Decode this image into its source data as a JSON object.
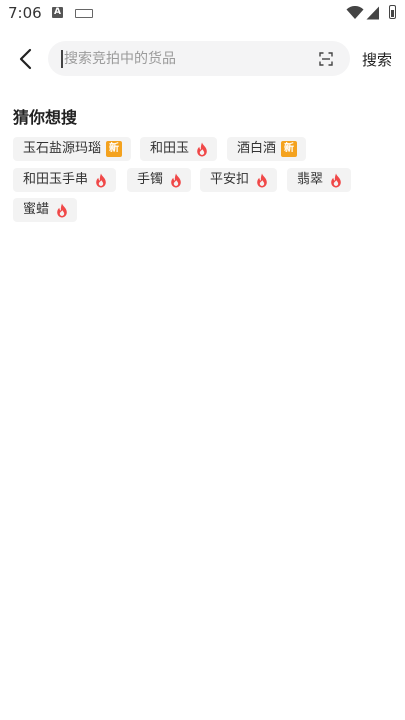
{
  "status_bar": {
    "time": "7:06",
    "notif_letter": "A"
  },
  "search": {
    "placeholder": "搜索竞拍中的货品",
    "button_label": "搜索"
  },
  "suggestions": {
    "title": "猜你想搜",
    "tags": [
      {
        "label": "玉石盐源玛瑙",
        "badge": "new",
        "badge_text": "新"
      },
      {
        "label": "和田玉",
        "badge": "hot"
      },
      {
        "label": "酒白酒",
        "badge": "new",
        "badge_text": "新"
      },
      {
        "label": "和田玉手串",
        "badge": "hot"
      },
      {
        "label": "手镯",
        "badge": "hot"
      },
      {
        "label": "平安扣",
        "badge": "hot"
      },
      {
        "label": "翡翠",
        "badge": "hot"
      },
      {
        "label": "蜜蜡",
        "badge": "hot"
      }
    ]
  },
  "colors": {
    "hot_icon": "#f04848",
    "new_badge": "#f4a21e",
    "tag_bg": "#f3f3f3",
    "search_bg": "#f4f4f5"
  }
}
